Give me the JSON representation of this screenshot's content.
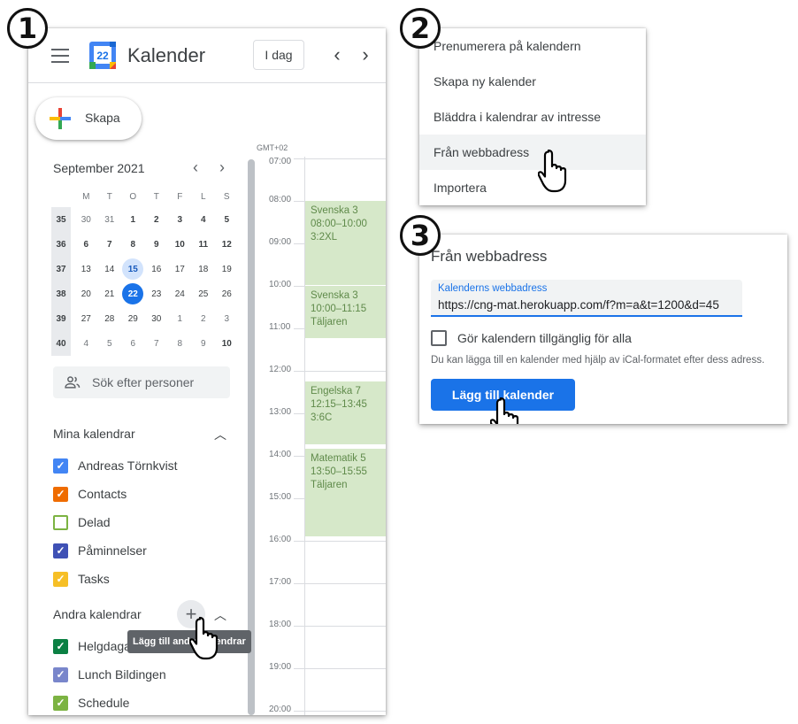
{
  "steps": [
    "1",
    "2",
    "3"
  ],
  "header": {
    "title": "Kalender",
    "logo_day": "22",
    "today_label": "I dag",
    "prev_icon": "‹",
    "next_icon": "›"
  },
  "create": {
    "label": "Skapa"
  },
  "mini_calendar": {
    "month_label": "September 2021",
    "weekdays": [
      "M",
      "T",
      "O",
      "T",
      "F",
      "L",
      "S"
    ],
    "weeks": [
      {
        "week": "35",
        "days": [
          "30",
          "31",
          "1",
          "2",
          "3",
          "4",
          "5"
        ]
      },
      {
        "week": "36",
        "days": [
          "6",
          "7",
          "8",
          "9",
          "10",
          "11",
          "12"
        ]
      },
      {
        "week": "37",
        "days": [
          "13",
          "14",
          "15",
          "16",
          "17",
          "18",
          "19"
        ]
      },
      {
        "week": "38",
        "days": [
          "20",
          "21",
          "22",
          "23",
          "24",
          "25",
          "26"
        ]
      },
      {
        "week": "39",
        "days": [
          "27",
          "28",
          "29",
          "30",
          "1",
          "2",
          "3"
        ]
      },
      {
        "week": "40",
        "days": [
          "4",
          "5",
          "6",
          "7",
          "8",
          "9",
          "10"
        ]
      }
    ],
    "today": "22",
    "selected": "15"
  },
  "people_search": {
    "placeholder": "Sök efter personer"
  },
  "my_calendars": {
    "title": "Mina kalendrar",
    "items": [
      {
        "label": "Andreas Törnkvist",
        "color": "#4285f4",
        "checked": true
      },
      {
        "label": "Contacts",
        "color": "#ef6c00",
        "checked": true
      },
      {
        "label": "Delad",
        "color": "#7cb342",
        "checked": false
      },
      {
        "label": "Påminnelser",
        "color": "#3f51b5",
        "checked": true
      },
      {
        "label": "Tasks",
        "color": "#f6bf26",
        "checked": true
      }
    ]
  },
  "other_calendars": {
    "title": "Andra kalendrar",
    "add_icon": "+",
    "tooltip": "Lägg till andra kalendrar",
    "items": [
      {
        "label": "Helgdagar i Sverige",
        "color": "#0b8043",
        "checked": true
      },
      {
        "label": "Lunch Bildingen",
        "color": "#7986cb",
        "checked": true
      },
      {
        "label": "Schedule",
        "color": "#7cb342",
        "checked": true
      }
    ]
  },
  "timeline": {
    "timezone": "GMT+02",
    "hours": [
      "07:00",
      "08:00",
      "09:00",
      "10:00",
      "11:00",
      "12:00",
      "13:00",
      "14:00",
      "15:00",
      "16:00",
      "17:00",
      "18:00",
      "19:00",
      "20:00"
    ],
    "events": [
      {
        "title": "Svenska 3",
        "time": "08:00–10:00",
        "room": "3:2XL",
        "start": "08:00",
        "end": "10:00"
      },
      {
        "title": "Svenska 3",
        "time": "10:00–11:15",
        "room": "Täljaren",
        "start": "10:00",
        "end": "11:15"
      },
      {
        "title": "Engelska 7",
        "time": "12:15–13:45",
        "room": "3:6C",
        "start": "12:15",
        "end": "13:45"
      },
      {
        "title": "Matematik 5",
        "time": "13:50–15:55",
        "room": "Täljaren",
        "start": "13:50",
        "end": "15:55"
      }
    ]
  },
  "add_menu": {
    "items": [
      {
        "label": "Prenumerera på kalendern"
      },
      {
        "label": "Skapa ny kalender"
      },
      {
        "label": "Bläddra i kalendrar av intresse"
      },
      {
        "label": "Från webbadress",
        "hover": true
      },
      {
        "label": "Importera"
      }
    ]
  },
  "url_dialog": {
    "title": "Från webbadress",
    "field_label": "Kalenderns webbadress",
    "field_value": "https://cng-mat.herokuapp.com/f?m=a&t=1200&d=45",
    "public_label": "Gör kalendern tillgänglig för alla",
    "public_checked": false,
    "help_text": "Du kan lägga till en kalender med hjälp av iCal-formatet efter dess adress.",
    "submit_label": "Lägg till kalender"
  },
  "colors": {
    "accent": "#1a73e8",
    "event_bg": "#d6e8c9",
    "event_text": "#5f8a4a"
  },
  "icons": [
    "menu-icon",
    "google-calendar-logo",
    "chevron-left-icon",
    "chevron-right-icon",
    "plus-icon",
    "people-icon",
    "chevron-up-icon",
    "checkbox-icon",
    "hand-pointer-cursor"
  ]
}
